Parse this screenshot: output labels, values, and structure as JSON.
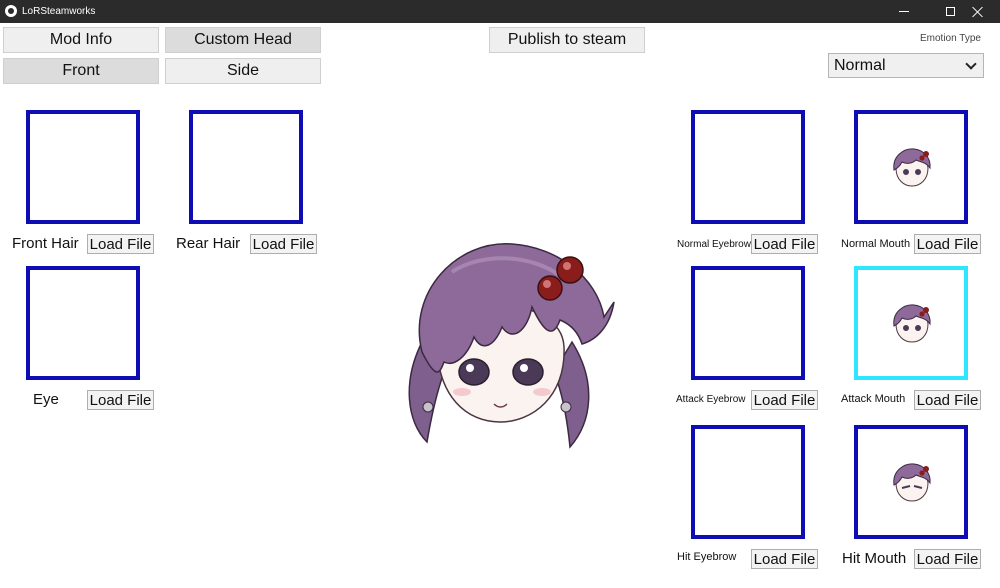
{
  "window": {
    "title": "LoRSteamworks"
  },
  "tabs": {
    "mod_info": "Mod Info",
    "custom_head": "Custom Head",
    "front": "Front",
    "side": "Side"
  },
  "toolbar": {
    "publish": "Publish to steam"
  },
  "emotion": {
    "label": "Emotion Type",
    "selected": "Normal"
  },
  "slots": {
    "front_hair": {
      "label": "Front Hair",
      "button": "Load File"
    },
    "rear_hair": {
      "label": "Rear Hair",
      "button": "Load File"
    },
    "eye": {
      "label": "Eye",
      "button": "Load File"
    },
    "normal_eyebrow": {
      "label": "Normal Eyebrow",
      "button": "Load File"
    },
    "normal_mouth": {
      "label": "Normal Mouth",
      "button": "Load File"
    },
    "attack_eyebrow": {
      "label": "Attack Eyebrow",
      "button": "Load File"
    },
    "attack_mouth": {
      "label": "Attack Mouth",
      "button": "Load File"
    },
    "hit_eyebrow": {
      "label": "Hit Eyebrow",
      "button": "Load File"
    },
    "hit_mouth": {
      "label": "Hit Mouth",
      "button": "Load File"
    }
  },
  "colors": {
    "slot_border": "#0d0db3",
    "slot_selected_border": "#2ee6ff",
    "hair": "#8d6a9a",
    "hair_ornament": "#8a1c1c"
  }
}
